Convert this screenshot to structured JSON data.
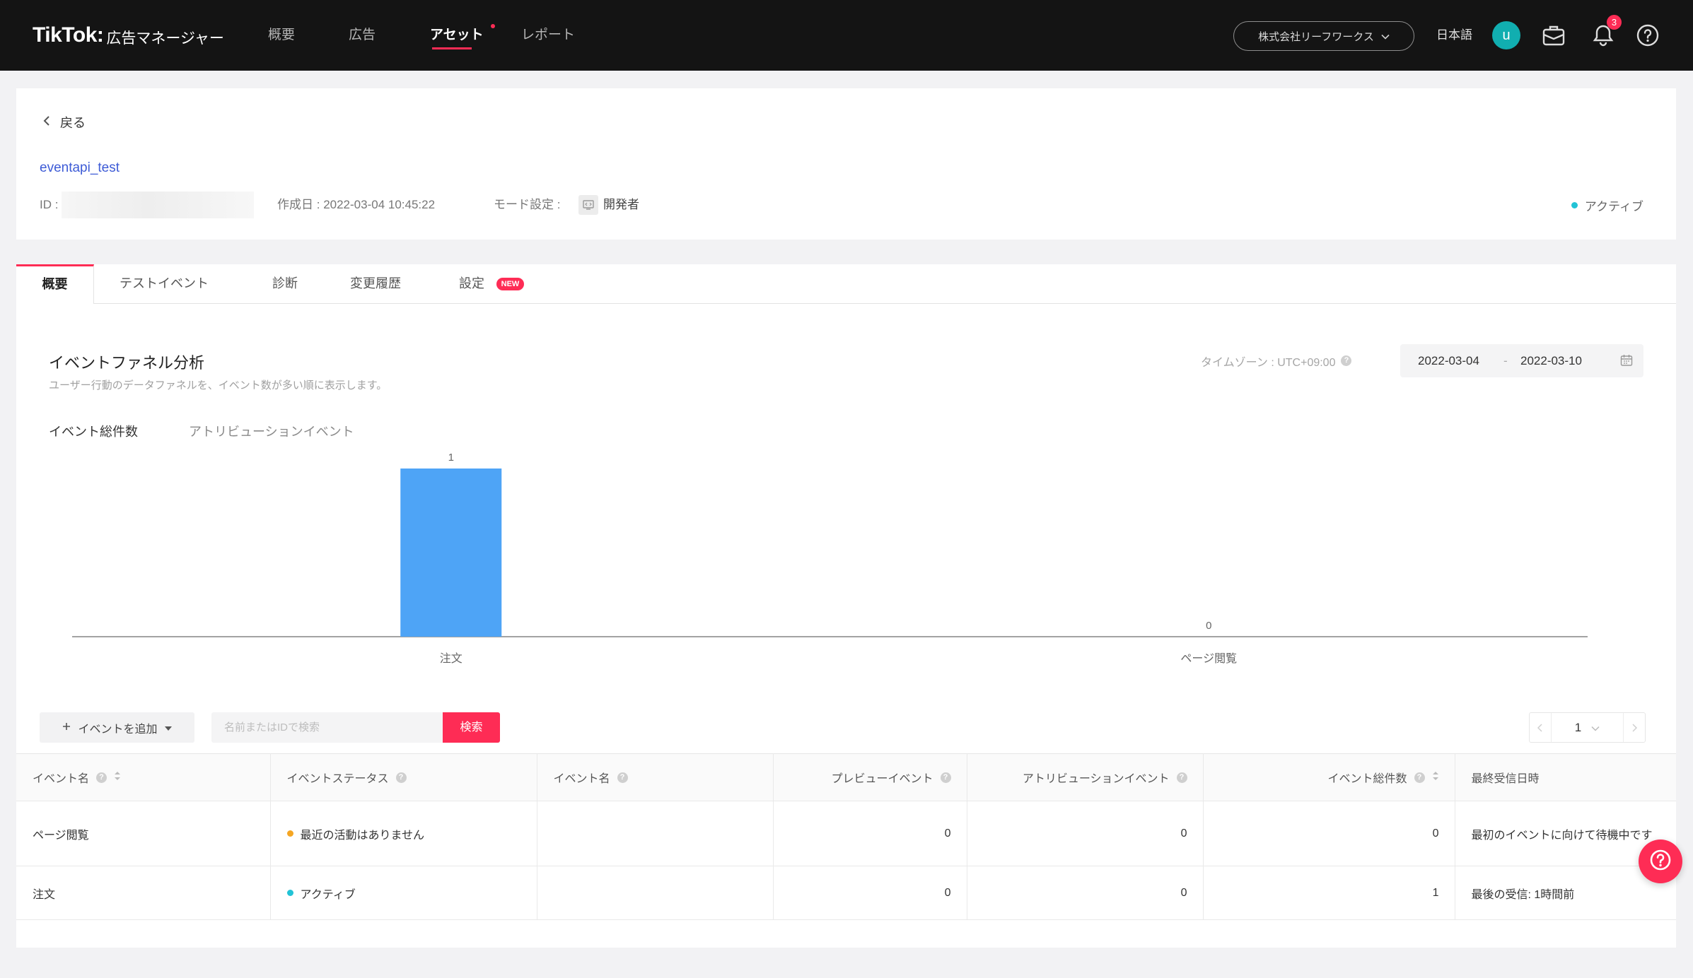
{
  "nav": {
    "logo": "TikTok:",
    "logo_sub": "広告マネージャー",
    "items": [
      {
        "label": "概要"
      },
      {
        "label": "広告"
      },
      {
        "label": "アセット",
        "active": true
      },
      {
        "label": "レポート"
      }
    ],
    "account": "株式会社リーフワークス",
    "language": "日本語",
    "avatar_initial": "u",
    "notification_count": "3",
    "icons": [
      "chevron-down-icon",
      "briefcase-icon",
      "bell-icon",
      "help-icon"
    ]
  },
  "header": {
    "back_label": "戻る",
    "name": "eventapi_test",
    "id_label": "ID :",
    "created_label": "作成日 :",
    "created_value": "2022-03-04 10:45:22",
    "mode_label": "モード設定 :",
    "mode_value": "開発者",
    "status": "アクティブ"
  },
  "tabs": [
    {
      "label": "概要",
      "active": true
    },
    {
      "label": "テストイベント"
    },
    {
      "label": "診断"
    },
    {
      "label": "変更履歴"
    },
    {
      "label": "設定",
      "badge": "NEW"
    }
  ],
  "funnel": {
    "title": "イベントファネル分析",
    "subtitle": "ユーザー行動のデータファネルを、イベント数が多い順に表示します。",
    "timezone_label": "タイムゾーン : UTC+09:00",
    "date_start": "2022-03-04",
    "date_sep": "-",
    "date_end": "2022-03-10",
    "metric_tabs": [
      {
        "label": "イベント総件数",
        "active": true
      },
      {
        "label": "アトリビューションイベント"
      }
    ]
  },
  "chart_data": {
    "type": "bar",
    "categories": [
      "注文",
      "ページ閲覧"
    ],
    "values": [
      1,
      0
    ],
    "ylim": [
      0,
      1
    ],
    "grid": false,
    "color": "#4ea4f6"
  },
  "toolbar": {
    "add_event_label": "イベントを追加",
    "search_placeholder": "名前またはIDで検索",
    "search_button": "検索",
    "page": "1"
  },
  "table": {
    "headers": [
      "イベント名",
      "イベントステータス",
      "イベント名",
      "プレビューイベント",
      "アトリビューションイベント",
      "イベント総件数",
      "最終受信日時"
    ],
    "rows": [
      {
        "event_name": "ページ閲覧",
        "status": "最近の活動はありません",
        "status_color": "#f5a623",
        "event_name_2": "",
        "preview": "0",
        "attribution": "0",
        "total": "0",
        "last_received": "最初のイベントに向けて待機中です"
      },
      {
        "event_name": "注文",
        "status": "アクティブ",
        "status_color": "#22c3d6",
        "event_name_2": "",
        "preview": "0",
        "attribution": "0",
        "total": "1",
        "last_received": "最後の受信: 1時間前"
      }
    ]
  },
  "colors": {
    "accent": "#fe2c55",
    "link": "#3d5bd6",
    "active_status": "#22c3d6",
    "pending_status": "#f5a623",
    "nav_bg": "#141414"
  }
}
